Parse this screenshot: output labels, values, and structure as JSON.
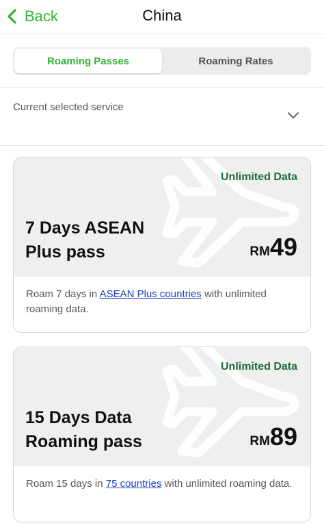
{
  "header": {
    "back_label": "Back",
    "title": "China"
  },
  "tabs": [
    {
      "label": "Roaming Passes",
      "active": true
    },
    {
      "label": "Roaming Rates",
      "active": false
    }
  ],
  "service": {
    "label": "Current selected service"
  },
  "passes": [
    {
      "badge": "Unlimited Data",
      "name_line1": "7 Days ASEAN",
      "name_line2": "Plus pass",
      "currency": "RM",
      "price": "49",
      "desc_before": "Roam 7 days in ",
      "desc_link": "ASEAN Plus countries",
      "desc_after": " with unlimited roaming data."
    },
    {
      "badge": "Unlimited Data",
      "name_line1": "15 Days Data",
      "name_line2": "Roaming pass",
      "currency": "RM",
      "price": "89",
      "desc_before": "Roam 15 days in ",
      "desc_link": "75 countries",
      "desc_after": " with unlimited roaming data."
    }
  ],
  "colors": {
    "accent": "#2fb52f",
    "badge": "#1e6b3a",
    "link": "#1a3fc2",
    "card_top": "#eef0ef"
  }
}
